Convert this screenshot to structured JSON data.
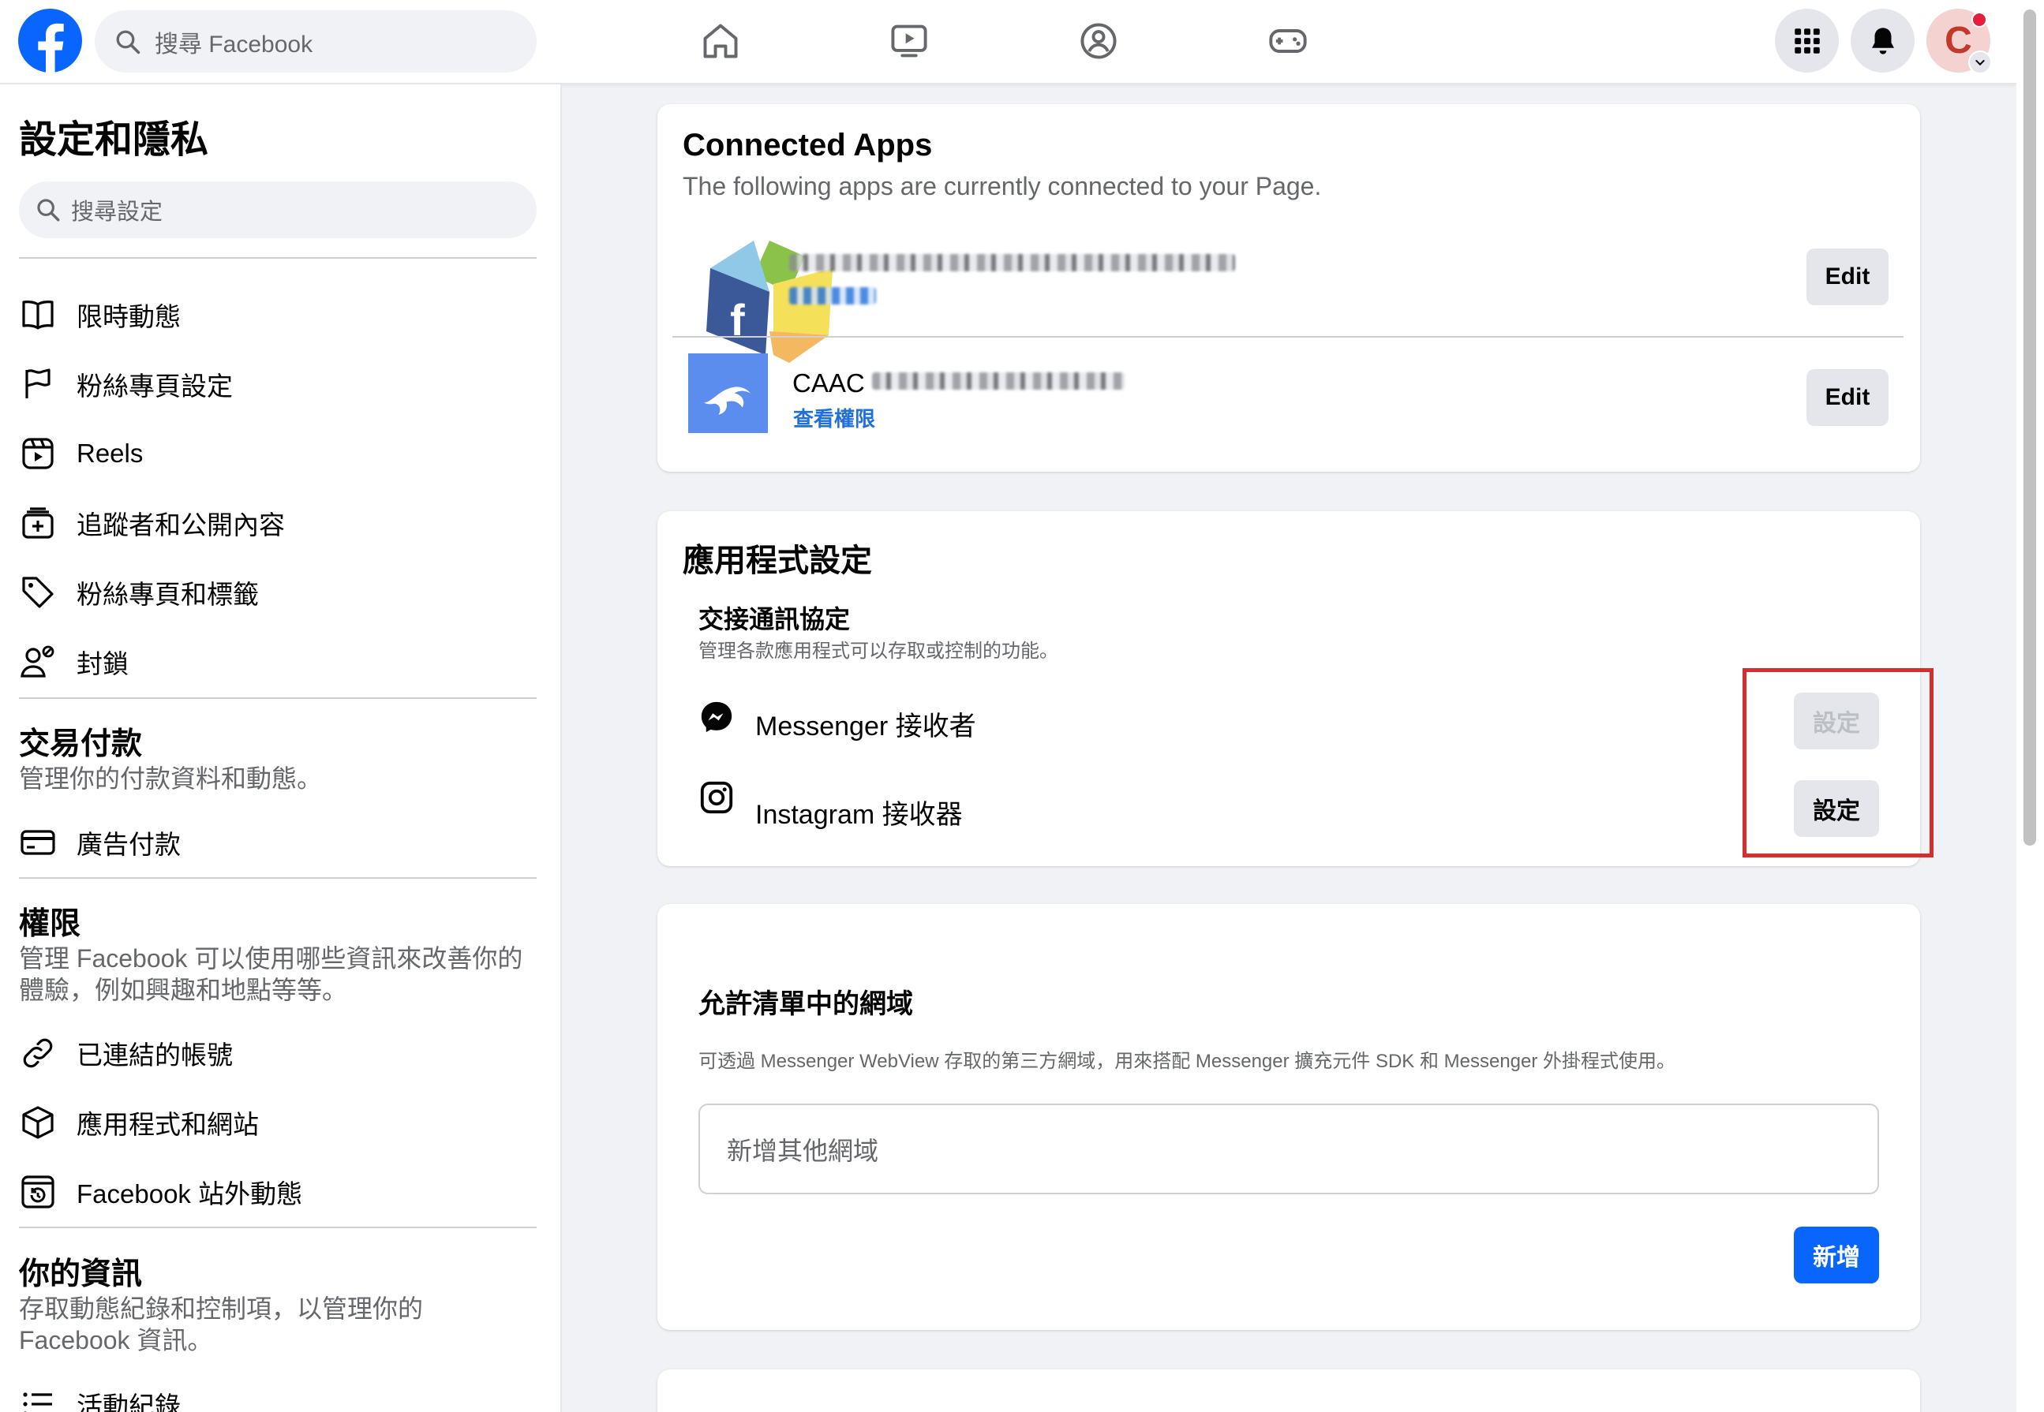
{
  "topbar": {
    "search_placeholder": "搜尋 Facebook",
    "avatar_letter": "C"
  },
  "sidebar": {
    "title": "設定和隱私",
    "search_placeholder": "搜尋設定",
    "items_a": [
      {
        "label": "限時動態",
        "icon": "book-icon"
      },
      {
        "label": "粉絲專頁設定",
        "icon": "flag-icon"
      },
      {
        "label": "Reels",
        "icon": "reels-icon"
      },
      {
        "label": "追蹤者和公開內容",
        "icon": "stack-plus-icon"
      },
      {
        "label": "粉絲專頁和標籤",
        "icon": "tag-icon"
      },
      {
        "label": "封鎖",
        "icon": "person-block-icon"
      }
    ],
    "payments": {
      "title": "交易付款",
      "desc": "管理你的付款資料和動態。",
      "items": [
        {
          "label": "廣告付款",
          "icon": "credit-card-icon"
        }
      ]
    },
    "permissions": {
      "title": "權限",
      "desc": "管理 Facebook 可以使用哪些資訊來改善你的體驗，例如興趣和地點等等。",
      "items": [
        {
          "label": "已連結的帳號",
          "icon": "link-icon"
        },
        {
          "label": "應用程式和網站",
          "icon": "cube-icon"
        },
        {
          "label": "Facebook 站外動態",
          "icon": "history-icon"
        }
      ]
    },
    "your_info": {
      "title": "你的資訊",
      "desc": "存取動態紀錄和控制項，以管理你的 Facebook 資訊。",
      "items": [
        {
          "label": "活動紀錄",
          "icon": "list-icon"
        }
      ]
    }
  },
  "connected_apps": {
    "title": "Connected Apps",
    "subtitle": "The following apps are currently connected to your Page.",
    "apps": [
      {
        "name": "",
        "link": "",
        "button": "Edit"
      },
      {
        "name": "CAAC",
        "link": "查看權限",
        "button": "Edit"
      }
    ]
  },
  "app_settings": {
    "title": "應用程式設定",
    "handover_title": "交接通訊協定",
    "handover_desc": "管理各款應用程式可以存取或控制的功能。",
    "receivers": [
      {
        "label": "Messenger 接收者",
        "button": "設定",
        "icon": "messenger-icon",
        "disabled": true
      },
      {
        "label": "Instagram 接收器",
        "button": "設定",
        "icon": "instagram-icon",
        "disabled": false
      }
    ]
  },
  "whitelist": {
    "title": "允許清單中的網域",
    "desc": "可透過 Messenger WebView 存取的第三方網域，用來搭配 Messenger 擴充元件 SDK 和 Messenger 外掛程式使用。",
    "input_placeholder": "新增其他網域",
    "add_button": "新增"
  },
  "colors": {
    "brand": "#0866ff",
    "link": "#216fdb",
    "highlight": "#d32f2f"
  }
}
